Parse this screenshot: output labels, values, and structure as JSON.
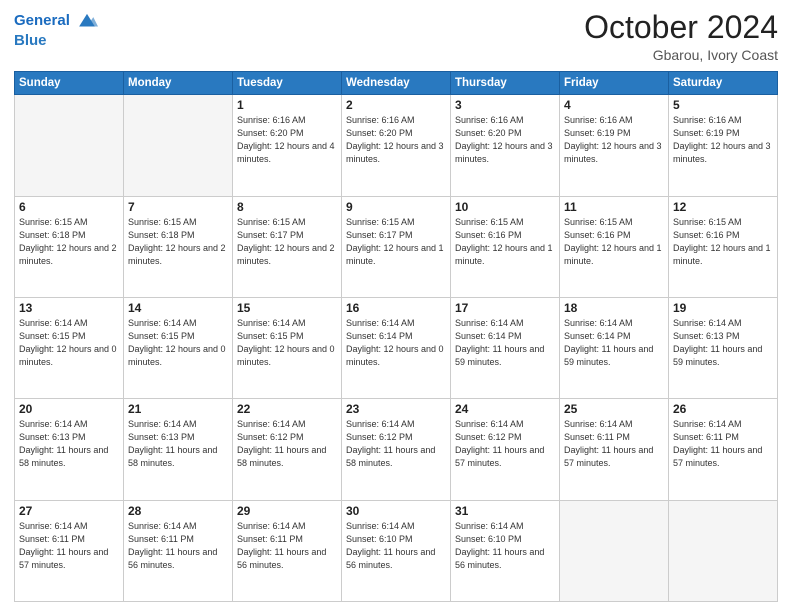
{
  "header": {
    "logo_line1": "General",
    "logo_line2": "Blue",
    "month": "October 2024",
    "location": "Gbarou, Ivory Coast"
  },
  "weekdays": [
    "Sunday",
    "Monday",
    "Tuesday",
    "Wednesday",
    "Thursday",
    "Friday",
    "Saturday"
  ],
  "weeks": [
    [
      {
        "day": "",
        "info": ""
      },
      {
        "day": "",
        "info": ""
      },
      {
        "day": "1",
        "info": "Sunrise: 6:16 AM\nSunset: 6:20 PM\nDaylight: 12 hours and 4 minutes."
      },
      {
        "day": "2",
        "info": "Sunrise: 6:16 AM\nSunset: 6:20 PM\nDaylight: 12 hours and 3 minutes."
      },
      {
        "day": "3",
        "info": "Sunrise: 6:16 AM\nSunset: 6:20 PM\nDaylight: 12 hours and 3 minutes."
      },
      {
        "day": "4",
        "info": "Sunrise: 6:16 AM\nSunset: 6:19 PM\nDaylight: 12 hours and 3 minutes."
      },
      {
        "day": "5",
        "info": "Sunrise: 6:16 AM\nSunset: 6:19 PM\nDaylight: 12 hours and 3 minutes."
      }
    ],
    [
      {
        "day": "6",
        "info": "Sunrise: 6:15 AM\nSunset: 6:18 PM\nDaylight: 12 hours and 2 minutes."
      },
      {
        "day": "7",
        "info": "Sunrise: 6:15 AM\nSunset: 6:18 PM\nDaylight: 12 hours and 2 minutes."
      },
      {
        "day": "8",
        "info": "Sunrise: 6:15 AM\nSunset: 6:17 PM\nDaylight: 12 hours and 2 minutes."
      },
      {
        "day": "9",
        "info": "Sunrise: 6:15 AM\nSunset: 6:17 PM\nDaylight: 12 hours and 1 minute."
      },
      {
        "day": "10",
        "info": "Sunrise: 6:15 AM\nSunset: 6:16 PM\nDaylight: 12 hours and 1 minute."
      },
      {
        "day": "11",
        "info": "Sunrise: 6:15 AM\nSunset: 6:16 PM\nDaylight: 12 hours and 1 minute."
      },
      {
        "day": "12",
        "info": "Sunrise: 6:15 AM\nSunset: 6:16 PM\nDaylight: 12 hours and 1 minute."
      }
    ],
    [
      {
        "day": "13",
        "info": "Sunrise: 6:14 AM\nSunset: 6:15 PM\nDaylight: 12 hours and 0 minutes."
      },
      {
        "day": "14",
        "info": "Sunrise: 6:14 AM\nSunset: 6:15 PM\nDaylight: 12 hours and 0 minutes."
      },
      {
        "day": "15",
        "info": "Sunrise: 6:14 AM\nSunset: 6:15 PM\nDaylight: 12 hours and 0 minutes."
      },
      {
        "day": "16",
        "info": "Sunrise: 6:14 AM\nSunset: 6:14 PM\nDaylight: 12 hours and 0 minutes."
      },
      {
        "day": "17",
        "info": "Sunrise: 6:14 AM\nSunset: 6:14 PM\nDaylight: 11 hours and 59 minutes."
      },
      {
        "day": "18",
        "info": "Sunrise: 6:14 AM\nSunset: 6:14 PM\nDaylight: 11 hours and 59 minutes."
      },
      {
        "day": "19",
        "info": "Sunrise: 6:14 AM\nSunset: 6:13 PM\nDaylight: 11 hours and 59 minutes."
      }
    ],
    [
      {
        "day": "20",
        "info": "Sunrise: 6:14 AM\nSunset: 6:13 PM\nDaylight: 11 hours and 58 minutes."
      },
      {
        "day": "21",
        "info": "Sunrise: 6:14 AM\nSunset: 6:13 PM\nDaylight: 11 hours and 58 minutes."
      },
      {
        "day": "22",
        "info": "Sunrise: 6:14 AM\nSunset: 6:12 PM\nDaylight: 11 hours and 58 minutes."
      },
      {
        "day": "23",
        "info": "Sunrise: 6:14 AM\nSunset: 6:12 PM\nDaylight: 11 hours and 58 minutes."
      },
      {
        "day": "24",
        "info": "Sunrise: 6:14 AM\nSunset: 6:12 PM\nDaylight: 11 hours and 57 minutes."
      },
      {
        "day": "25",
        "info": "Sunrise: 6:14 AM\nSunset: 6:11 PM\nDaylight: 11 hours and 57 minutes."
      },
      {
        "day": "26",
        "info": "Sunrise: 6:14 AM\nSunset: 6:11 PM\nDaylight: 11 hours and 57 minutes."
      }
    ],
    [
      {
        "day": "27",
        "info": "Sunrise: 6:14 AM\nSunset: 6:11 PM\nDaylight: 11 hours and 57 minutes."
      },
      {
        "day": "28",
        "info": "Sunrise: 6:14 AM\nSunset: 6:11 PM\nDaylight: 11 hours and 56 minutes."
      },
      {
        "day": "29",
        "info": "Sunrise: 6:14 AM\nSunset: 6:11 PM\nDaylight: 11 hours and 56 minutes."
      },
      {
        "day": "30",
        "info": "Sunrise: 6:14 AM\nSunset: 6:10 PM\nDaylight: 11 hours and 56 minutes."
      },
      {
        "day": "31",
        "info": "Sunrise: 6:14 AM\nSunset: 6:10 PM\nDaylight: 11 hours and 56 minutes."
      },
      {
        "day": "",
        "info": ""
      },
      {
        "day": "",
        "info": ""
      }
    ]
  ]
}
